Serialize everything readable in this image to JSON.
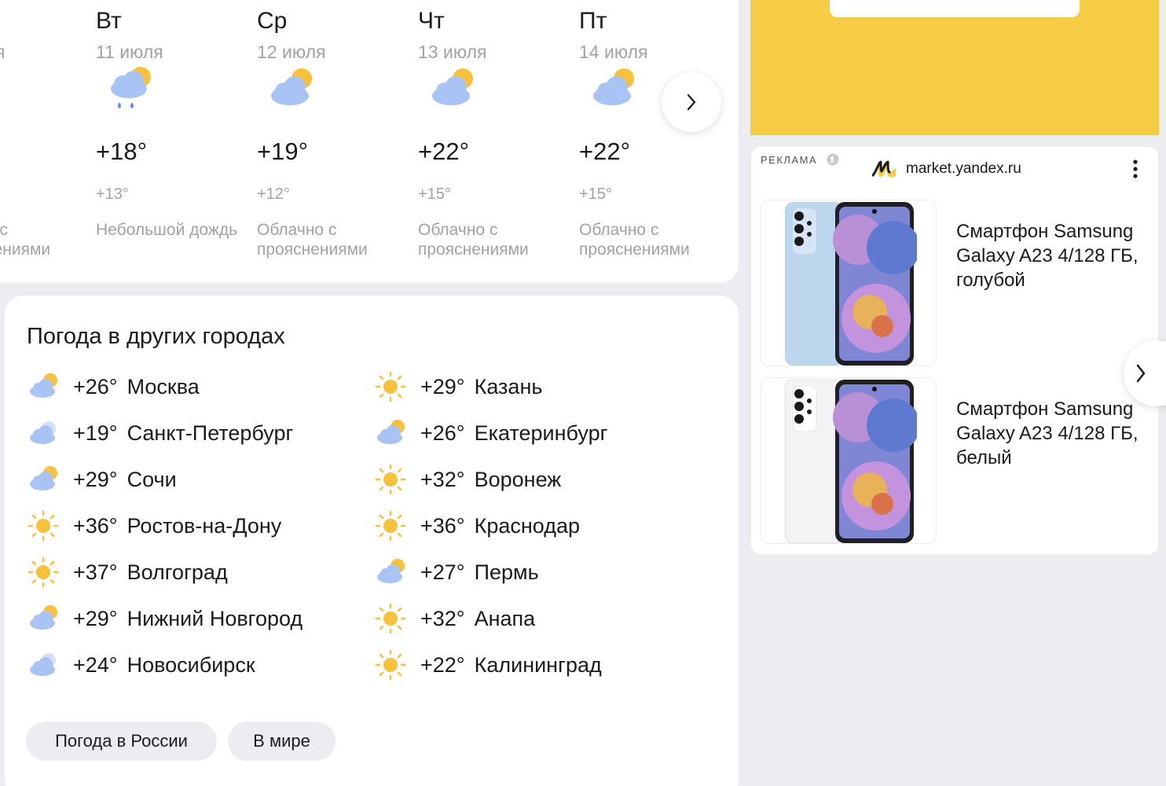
{
  "forecast": {
    "partial_day": {
      "date_fragment": "я",
      "condition_line1": "о с",
      "condition_line2": "нениями"
    },
    "days": [
      {
        "day": "Вт",
        "date": "11 июля",
        "icon": "rain-icon",
        "high": "+18°",
        "low": "+13°",
        "condition": "Небольшой дождь"
      },
      {
        "day": "Ср",
        "date": "12 июля",
        "icon": "partly-cloudy-icon",
        "high": "+19°",
        "low": "+12°",
        "condition": "Облачно с прояснениями"
      },
      {
        "day": "Чт",
        "date": "13 июля",
        "icon": "partly-cloudy-icon",
        "high": "+22°",
        "low": "+15°",
        "condition": "Облачно с прояснениями"
      },
      {
        "day": "Пт",
        "date": "14 июля",
        "icon": "partly-cloudy-icon",
        "high": "+22°",
        "low": "+15°",
        "condition": "Облачно с прояснениями"
      }
    ],
    "next_button_icon": "chevron-right-icon"
  },
  "other_cities": {
    "title": "Погода в других городах",
    "left_column": [
      {
        "temp": "+26°",
        "name": "Москва",
        "icon": "partly-cloudy-icon"
      },
      {
        "temp": "+19°",
        "name": "Санкт-Петербург",
        "icon": "cloudy-icon"
      },
      {
        "temp": "+29°",
        "name": "Сочи",
        "icon": "partly-cloudy-icon"
      },
      {
        "temp": "+36°",
        "name": "Ростов-на-Дону",
        "icon": "sun-icon"
      },
      {
        "temp": "+37°",
        "name": "Волгоград",
        "icon": "sun-icon"
      },
      {
        "temp": "+29°",
        "name": "Нижний Новгород",
        "icon": "partly-cloudy-icon"
      },
      {
        "temp": "+24°",
        "name": "Новосибирск",
        "icon": "cloudy-icon"
      }
    ],
    "right_column": [
      {
        "temp": "+29°",
        "name": "Казань",
        "icon": "sun-icon"
      },
      {
        "temp": "+26°",
        "name": "Екатеринбург",
        "icon": "partly-cloudy-icon"
      },
      {
        "temp": "+32°",
        "name": "Воронеж",
        "icon": "sun-icon"
      },
      {
        "temp": "+36°",
        "name": "Краснодар",
        "icon": "sun-icon"
      },
      {
        "temp": "+27°",
        "name": "Пермь",
        "icon": "partly-cloudy-icon"
      },
      {
        "temp": "+32°",
        "name": "Анапа",
        "icon": "sun-icon"
      },
      {
        "temp": "+22°",
        "name": "Калининград",
        "icon": "sun-icon"
      }
    ],
    "buttons": {
      "russia": "Погода в России",
      "world": "В мире"
    }
  },
  "ad": {
    "label": "РЕКЛАМА",
    "domain": "market.yandex.ru",
    "products": [
      {
        "title": "Смартфон Samsung Galaxy A23 4/128 ГБ, голубой",
        "color": "#bcd6ee"
      },
      {
        "title": "Смартфон Samsung Galaxy A23 4/128 ГБ, белый",
        "color": "#f3f3f5"
      }
    ]
  },
  "colors": {
    "background": "#ecedf1",
    "card": "#ffffff",
    "banner_yellow": "#f7cc45",
    "muted_text": "#a1a1a6",
    "sun": "#f8c13c",
    "cloud": "#a9c3f4",
    "rain": "#5b8fe6"
  }
}
